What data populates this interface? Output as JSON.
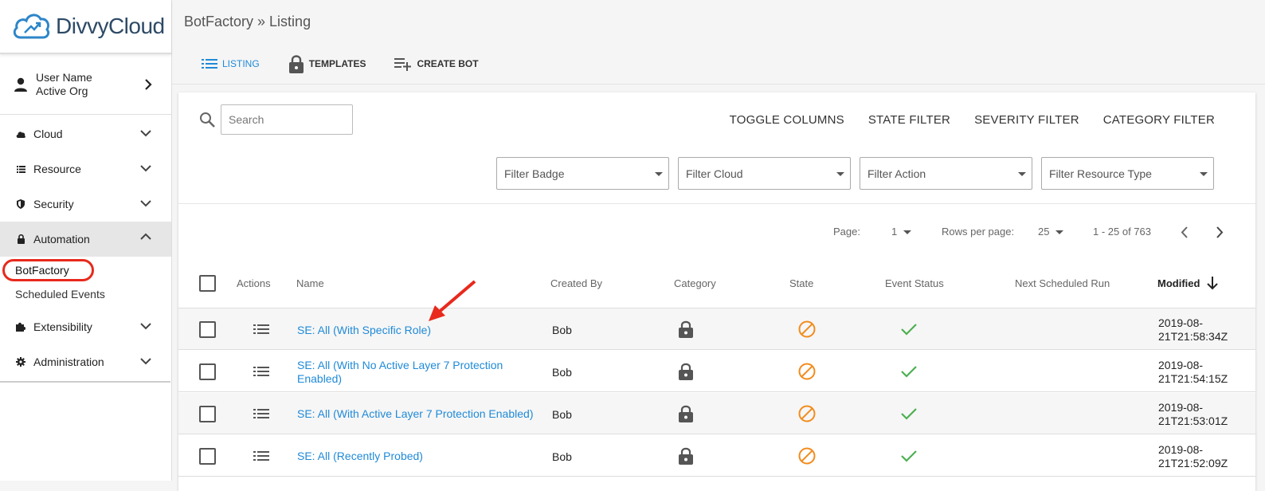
{
  "app": {
    "logo_text": "DivvyCloud"
  },
  "sidebar": {
    "user_name": "User Name",
    "org_name": "Active Org",
    "items": [
      {
        "label": "Cloud",
        "icon": "cloud-icon"
      },
      {
        "label": "Resource",
        "icon": "list-icon"
      },
      {
        "label": "Security",
        "icon": "shield-icon"
      },
      {
        "label": "Automation",
        "icon": "lock-icon"
      },
      {
        "label": "Extensibility",
        "icon": "puzzle-icon"
      },
      {
        "label": "Administration",
        "icon": "gear-icon"
      }
    ],
    "automation_sub": [
      "BotFactory",
      "Scheduled Events"
    ]
  },
  "header": {
    "breadcrumb": "BotFactory » Listing",
    "tabs": [
      "LISTING",
      "TEMPLATES",
      "CREATE BOT"
    ]
  },
  "toolbar": {
    "search_placeholder": "Search",
    "actions": [
      "TOGGLE COLUMNS",
      "STATE FILTER",
      "SEVERITY FILTER",
      "CATEGORY FILTER"
    ],
    "filters": [
      "Filter Badge",
      "Filter Cloud",
      "Filter Action",
      "Filter Resource Type"
    ]
  },
  "pagination": {
    "page_label": "Page:",
    "page": "1",
    "rows_label": "Rows per page:",
    "rows": "25",
    "range": "1 - 25 of 763"
  },
  "table": {
    "columns": [
      "Actions",
      "Name",
      "Created By",
      "Category",
      "State",
      "Event Status",
      "Next Scheduled Run",
      "Modified"
    ],
    "rows": [
      {
        "name": "SE: All (With Specific Role)",
        "created_by": "Bob",
        "modified_1": "2019-08-",
        "modified_2": "21T21:58:34Z"
      },
      {
        "name": "SE: All (With No Active Layer 7 Protection Enabled)",
        "created_by": "Bob",
        "modified_1": "2019-08-",
        "modified_2": "21T21:54:15Z"
      },
      {
        "name": "SE: All (With Active Layer 7 Protection Enabled)",
        "created_by": "Bob",
        "modified_1": "2019-08-",
        "modified_2": "21T21:53:01Z"
      },
      {
        "name": "SE: All (Recently Probed)",
        "created_by": "Bob",
        "modified_1": "2019-08-",
        "modified_2": "21T21:52:09Z"
      }
    ]
  },
  "colors": {
    "accent": "#1f8ad8",
    "state": "#f28c1c",
    "ok": "#4caf50",
    "annotation": "#e8291c"
  }
}
